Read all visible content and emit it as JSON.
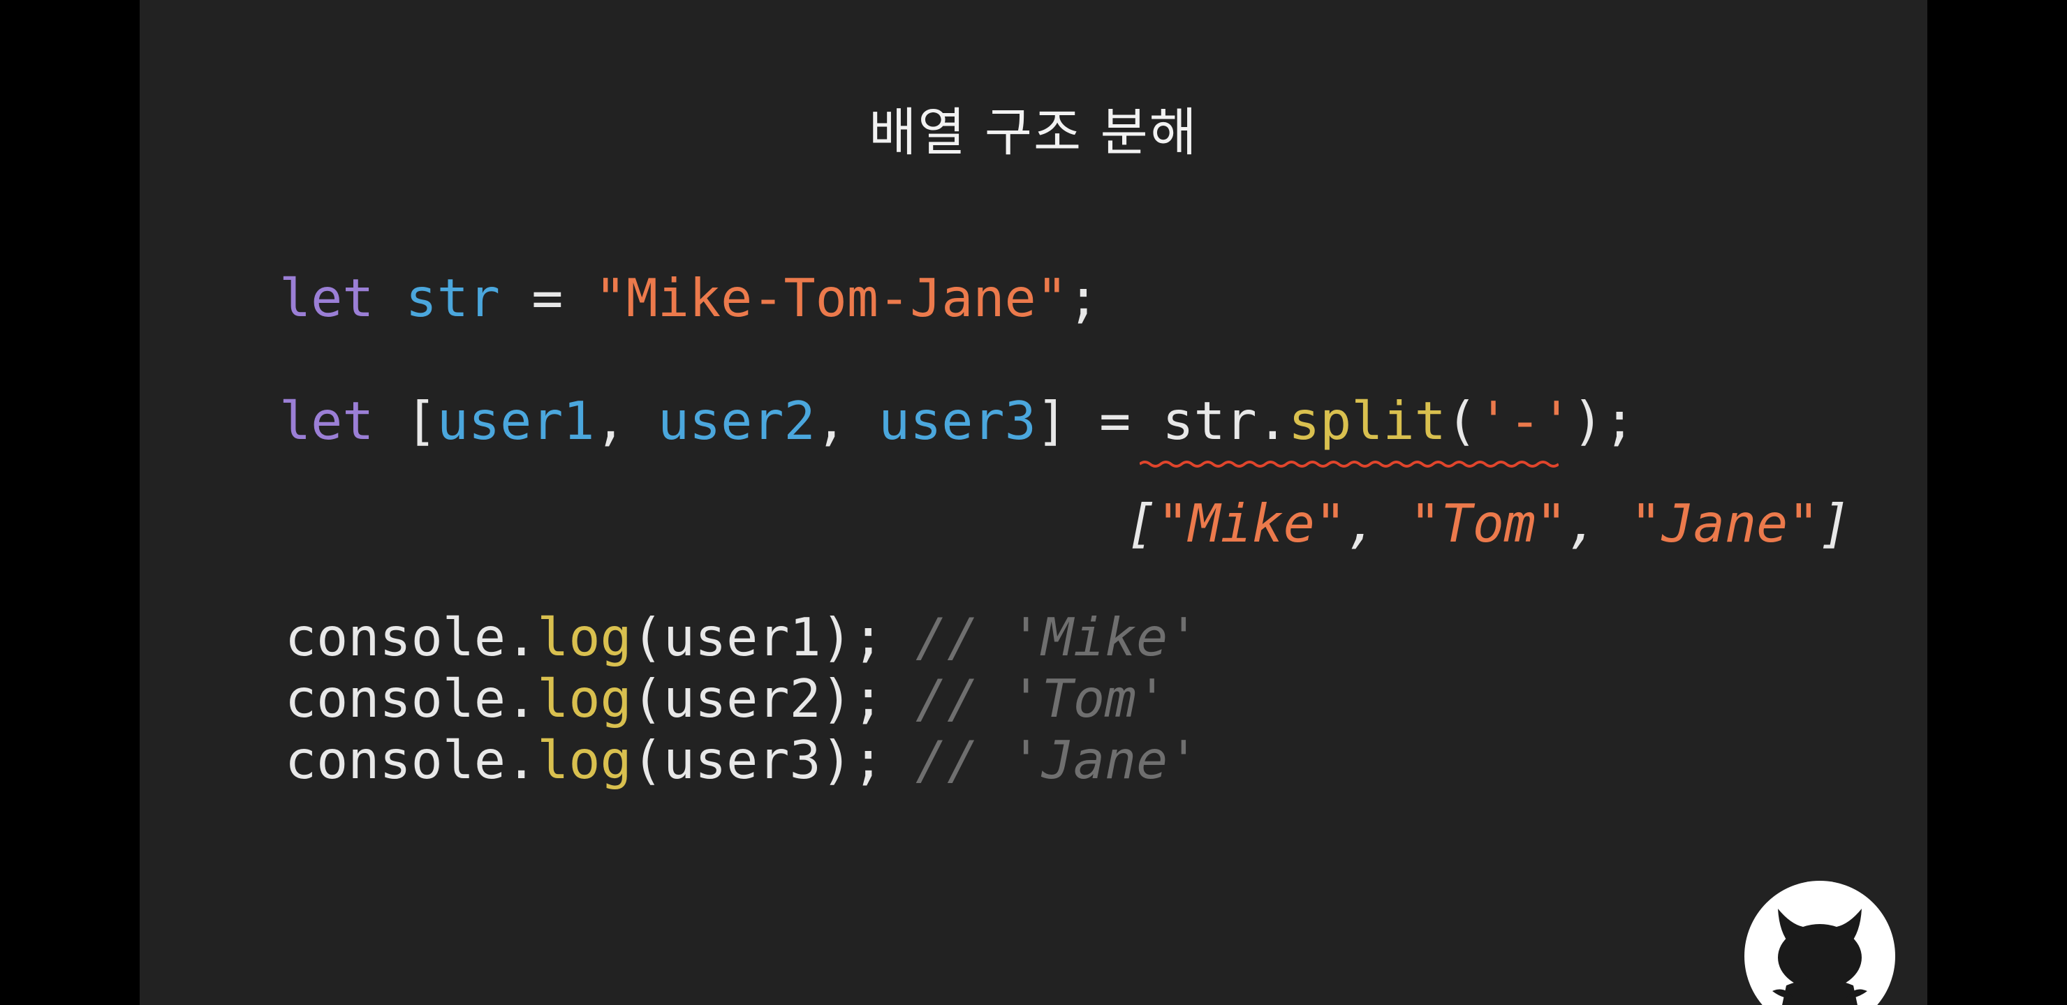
{
  "slide": {
    "title": "배열 구조 분해"
  },
  "code": {
    "line1": {
      "kw": "let",
      "var": "str",
      "op": "=",
      "string": "\"Mike-Tom-Jane\"",
      "end": ";"
    },
    "line2": {
      "kw": "let",
      "open": "[",
      "vars": [
        "user1",
        "user2",
        "user3"
      ],
      "close": "]",
      "op": "=",
      "obj": "str",
      "dot": ".",
      "method": "split",
      "paren_open": "(",
      "arg": "'-'",
      "paren_close": ")",
      "end": ";"
    },
    "result": {
      "open": "[",
      "items": [
        "\"Mike\"",
        "\"Tom\"",
        "\"Jane\""
      ],
      "close": "]"
    },
    "logs": [
      {
        "obj": "console",
        "method": "log",
        "arg": "user1",
        "comment": "// 'Mike'"
      },
      {
        "obj": "console",
        "method": "log",
        "arg": "user2",
        "comment": "// 'Tom'"
      },
      {
        "obj": "console",
        "method": "log",
        "arg": "user3",
        "comment": "// 'Jane'"
      }
    ]
  },
  "colors": {
    "background": "#222222",
    "keyword": "#9b7fd6",
    "variable": "#4ba7dd",
    "string": "#ec7a4c",
    "function": "#d9c04f",
    "comment": "#6f6f6f",
    "underline": "#e0452c"
  },
  "icons": [
    "devil-cat-logo-icon"
  ]
}
